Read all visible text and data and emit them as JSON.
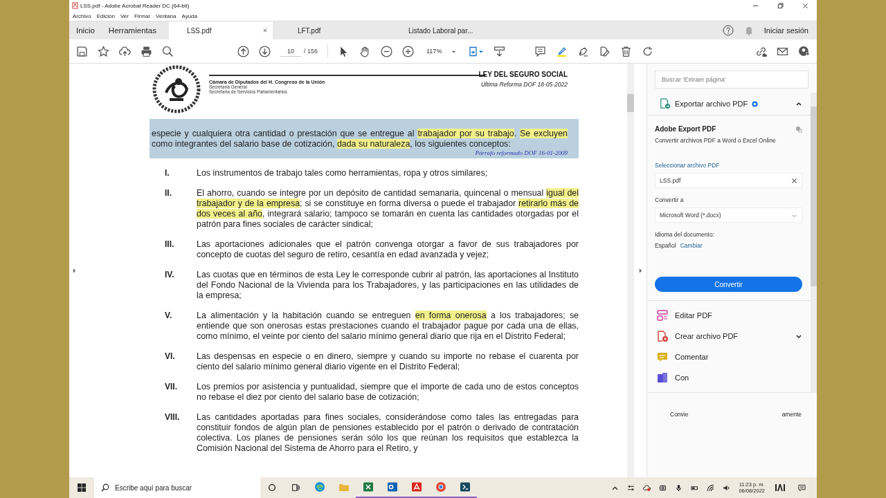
{
  "window": {
    "title": "LSS.pdf - Adobe Acrobat Reader DC (64-bit)"
  },
  "menu": [
    "Archivo",
    "Edición",
    "Ver",
    "Firmar",
    "Ventana",
    "Ayuda"
  ],
  "nav_tabs": [
    "Inicio",
    "Herramientas"
  ],
  "doc_tabs": [
    {
      "label": "LSS.pdf",
      "selected": true,
      "closable": true
    },
    {
      "label": "LFT.pdf",
      "selected": false,
      "closable": false
    },
    {
      "label": "Listado Laboral par...",
      "selected": false,
      "closable": false
    }
  ],
  "sign_in": "Iniciar sesión",
  "toolbar": {
    "page": "10",
    "total": "/ 156",
    "zoom": "117%"
  },
  "document": {
    "header_title": "LEY DEL SEGURO SOCIAL",
    "header_org": "Cámara de Diputados del H. Congreso de la Unión",
    "header_lines": [
      "Secretaría General",
      "Secretaría de Servicios Parlamentarios"
    ],
    "reform": "Última Reforma DOF 18-05-2022",
    "intro": [
      {
        "text": "especie y cualquiera otra cantidad o prestación que se entregue al ",
        "highlighted": false
      },
      {
        "text": "trabajador por su trabajo",
        "highlighted": true
      },
      {
        "text": ". ",
        "highlighted": false
      },
      {
        "text": "Se excluyen",
        "highlighted": true
      },
      {
        "text": " como integrantes del salario base de cotización, ",
        "highlighted": false
      },
      {
        "text": "dada su naturaleza",
        "highlighted": true
      },
      {
        "text": ", los siguientes conceptos:",
        "highlighted": false
      }
    ],
    "intro_note": "Párrafo reformado DOF 16-01-2009",
    "items": [
      {
        "numeral": "I.",
        "segments": [
          {
            "text": "Los instrumentos de trabajo tales como herramientas, ropa y otros similares;",
            "highlighted": false
          }
        ]
      },
      {
        "numeral": "II.",
        "segments": [
          {
            "text": "El ahorro, cuando se integre por un depósito de cantidad semanaria, quincenal o mensual ",
            "highlighted": false
          },
          {
            "text": "igual del trabajador y de la empresa",
            "highlighted": true
          },
          {
            "text": "; si se constituye en forma diversa o puede el trabajador ",
            "highlighted": false
          },
          {
            "text": "retirarlo más de dos veces al año",
            "highlighted": true
          },
          {
            "text": ", integrará salario; tampoco se tomarán en cuenta las cantidades otorgadas por el patrón para fines sociales de carácter sindical;",
            "highlighted": false
          }
        ]
      },
      {
        "numeral": "III.",
        "segments": [
          {
            "text": "Las aportaciones adicionales que el patrón convenga otorgar a favor de sus trabajadores por concepto de cuotas del seguro de retiro, cesantía en edad avanzada y vejez;",
            "highlighted": false
          }
        ]
      },
      {
        "numeral": "IV.",
        "segments": [
          {
            "text": "Las cuotas que en términos de esta Ley le corresponde cubrir al patrón, las aportaciones al Instituto del Fondo Nacional de la Vivienda para los Trabajadores, y las participaciones en las utilidades de la empresa;",
            "highlighted": false
          }
        ]
      },
      {
        "numeral": "V.",
        "segments": [
          {
            "text": "La alimentación y la habitación cuando se entreguen ",
            "highlighted": false
          },
          {
            "text": "en forma onerosa",
            "highlighted": true
          },
          {
            "text": " a los trabajadores; se entiende que son onerosas estas prestaciones cuando el trabajador pague por cada una de ellas, como mínimo, el veinte por ciento del salario mínimo general diario que rija en el Distrito Federal;",
            "highlighted": false
          }
        ]
      },
      {
        "numeral": "VI.",
        "segments": [
          {
            "text": "Las despensas en especie o en dinero, siempre y cuando su importe no rebase el cuarenta por ciento del salario mínimo general diario vigente en el Distrito Federal;",
            "highlighted": false
          }
        ]
      },
      {
        "numeral": "VII.",
        "segments": [
          {
            "text": "Los premios por asistencia y puntualidad, siempre que el importe de cada uno de estos conceptos no rebase el diez por ciento del salario base de cotización;",
            "highlighted": false
          }
        ]
      },
      {
        "numeral": "VIII.",
        "segments": [
          {
            "text": "Las cantidades aportadas para fines sociales, considerándose como tales las entregadas para constituir fondos de algún plan de pensiones establecido por el patrón o derivado de contratación colectiva. Los planes de pensiones serán sólo los que reúnan los requisitos que establezca la Comisión Nacional del Sistema de Ahorro para el Retiro, y",
            "highlighted": false
          }
        ]
      }
    ]
  },
  "right_panel": {
    "search": {
      "placeholder": "Buscar 'Extraer página'"
    },
    "section": {
      "title": "Exportar archivo PDF",
      "expanded": true
    },
    "export_title": "Adobe Export PDF",
    "export_desc": "Convertir archivos PDF a Word o Excel Online",
    "select_label": "Seleccionar archivo PDF",
    "file": {
      "value": "LSS.pdf"
    },
    "convert_label": "Convertir a",
    "format": {
      "value": "Microsoft Word (*.docx)"
    },
    "language_label": "Idioma del documento:",
    "language": "Español",
    "change_link": "Cambiar",
    "convert_button": "Convertir",
    "tools": [
      {
        "kind": "edit",
        "label": "Editar PDF",
        "expandable": false
      },
      {
        "kind": "create",
        "label": "Crear archivo PDF",
        "expandable": true
      },
      {
        "kind": "comment",
        "label": "Comentar",
        "expandable": false
      },
      {
        "kind": "combine",
        "label": "Con",
        "expandable": false
      }
    ],
    "footer": [
      "Convie",
      "amente"
    ]
  },
  "taskbar": {
    "search": {
      "placeholder": "Escribe aquí para buscar"
    },
    "apps": [
      {
        "kind": "edge",
        "running": false
      },
      {
        "kind": "explorer",
        "running": false
      },
      {
        "kind": "excel",
        "running": true
      },
      {
        "kind": "outlook",
        "running": true
      },
      {
        "kind": "acrobat",
        "running": true
      },
      {
        "kind": "chrome",
        "running": true
      },
      {
        "kind": "terminal",
        "running": true
      }
    ],
    "time": "11:23 p. m.",
    "date": "06/08/2022"
  }
}
